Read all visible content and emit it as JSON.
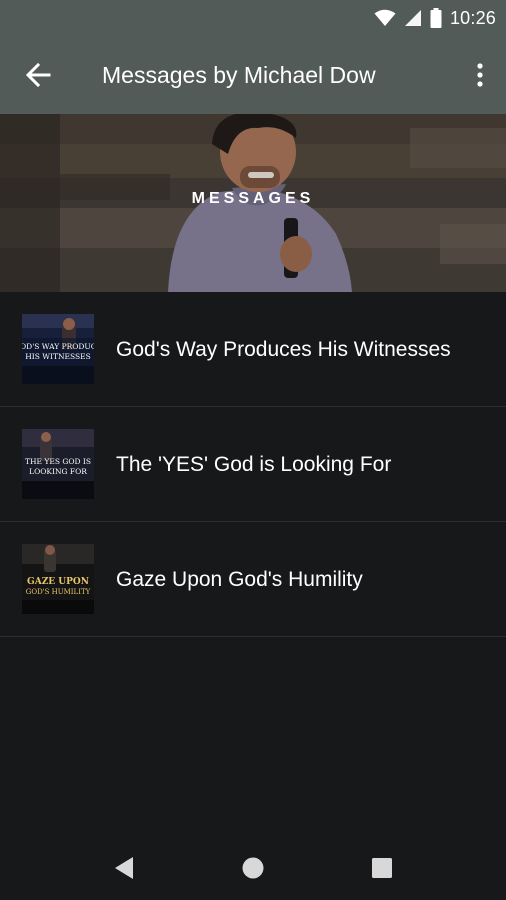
{
  "status_bar": {
    "time": "10:26",
    "icons": [
      "wifi-icon",
      "signal-icon",
      "battery-icon"
    ]
  },
  "app_bar": {
    "title": "Messages by Michael Dow",
    "back_icon": "arrow-back-icon",
    "menu_icon": "more-vert-icon"
  },
  "banner": {
    "label": "MESSAGES"
  },
  "messages": [
    {
      "title": "God's Way Produces His Witnesses",
      "thumb_text": [
        "GOD'S WAY PRODUCE",
        "HIS WITNESSES"
      ]
    },
    {
      "title": "The 'YES' God is Looking For",
      "thumb_text": [
        "THE YES GOD IS",
        "LOOKING FOR"
      ]
    },
    {
      "title": "Gaze Upon God's Humility",
      "thumb_text": [
        "GAZE UPON",
        "GOD'S HUMILITY"
      ]
    }
  ],
  "nav_bar": {
    "icons": [
      "back-triangle-icon",
      "home-circle-icon",
      "recents-square-icon"
    ]
  },
  "colors": {
    "app_bar": "#525b58",
    "background": "#17181a",
    "divider": "#2b2d30"
  }
}
